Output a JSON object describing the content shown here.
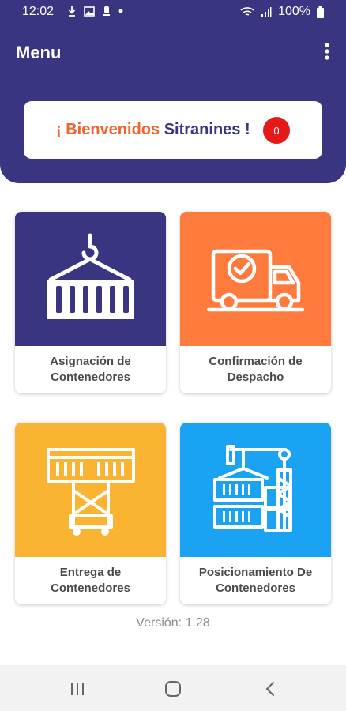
{
  "status_bar": {
    "time": "12:02",
    "battery": "100%"
  },
  "app_bar": {
    "title": "Menu"
  },
  "welcome": {
    "greeting": "¡ Bienvenidos",
    "name": "Sitranines !",
    "badge_count": "0"
  },
  "menu": [
    {
      "line1": "Asignación de",
      "line2": "Contenedores",
      "color": "#3a3580",
      "icon": "container-crane-hook-icon"
    },
    {
      "line1": "Confirmación de",
      "line2": "Despacho",
      "color": "#ff7a3d",
      "icon": "delivery-truck-check-icon"
    },
    {
      "line1": "Entrega de",
      "line2": "Contenedores",
      "color": "#fbb431",
      "icon": "gantry-crane-icon"
    },
    {
      "line1": "Posicionamiento De",
      "line2": "Contenedores",
      "color": "#1aa3f2",
      "icon": "stacked-containers-crane-icon"
    }
  ],
  "version": "Versión: 1.28",
  "colors": {
    "primary": "#3a3580",
    "accent": "#f0652c",
    "badge": "#e61919"
  }
}
